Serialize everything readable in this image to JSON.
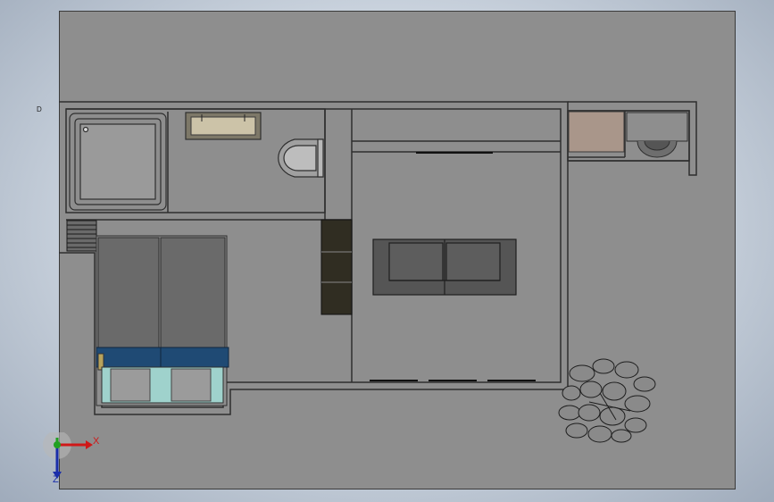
{
  "viewport": {
    "corner_marker": "D",
    "axes": {
      "x_label": "X",
      "z_label": "Z"
    }
  },
  "colors": {
    "sheet": "#8e8e8e",
    "wall_line": "#2e2e2e",
    "sofa": "#555555",
    "bed_blanket": "#1f4a74",
    "bed_frame": "#9fd2cc",
    "cabinet": "#302d22",
    "wardrobe_tint": "#a9968a",
    "axis_x": "#d01818",
    "axis_y": "#22a022",
    "axis_z": "#1a2eaa"
  },
  "icons": [
    "triad-axis-icon",
    "toilet-icon",
    "shower-tray-icon",
    "washing-machine-icon",
    "plant-icon",
    "sofa-icon",
    "bed-icon"
  ]
}
